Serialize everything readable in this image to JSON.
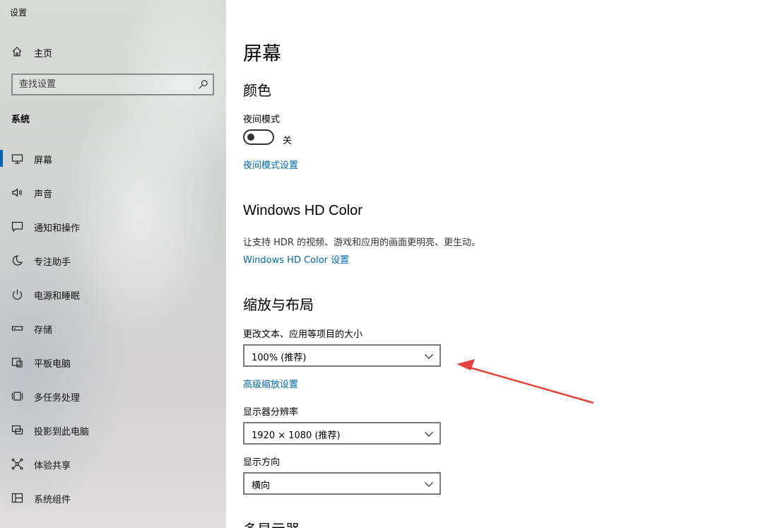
{
  "app": {
    "title": "设置"
  },
  "sidebar": {
    "home_label": "主页",
    "search_placeholder": "查找设置",
    "section_label": "系统",
    "items": [
      {
        "label": "屏幕",
        "icon": "monitor-icon",
        "active": true
      },
      {
        "label": "声音",
        "icon": "speaker-icon"
      },
      {
        "label": "通知和操作",
        "icon": "notification-icon"
      },
      {
        "label": "专注助手",
        "icon": "moon-icon"
      },
      {
        "label": "电源和睡眠",
        "icon": "power-icon"
      },
      {
        "label": "存储",
        "icon": "storage-icon"
      },
      {
        "label": "平板电脑",
        "icon": "tablet-icon"
      },
      {
        "label": "多任务处理",
        "icon": "multitask-icon"
      },
      {
        "label": "投影到此电脑",
        "icon": "project-icon"
      },
      {
        "label": "体验共享",
        "icon": "share-icon"
      },
      {
        "label": "系统组件",
        "icon": "components-icon"
      }
    ]
  },
  "main": {
    "page_title": "屏幕",
    "color": {
      "heading": "颜色",
      "night_mode_label": "夜间模式",
      "night_mode_state": "关",
      "night_mode_link": "夜间模式设置"
    },
    "hdr": {
      "heading": "Windows HD Color",
      "description": "让支持 HDR 的视频、游戏和应用的画面更明亮、更生动。",
      "link": "Windows HD Color 设置"
    },
    "scale": {
      "heading": "缩放与布局",
      "size_label": "更改文本、应用等项目的大小",
      "size_value": "100% (推荐)",
      "advanced_link": "高级缩放设置",
      "resolution_label": "显示器分辨率",
      "resolution_value": "1920 × 1080 (推荐)",
      "orientation_label": "显示方向",
      "orientation_value": "横向"
    },
    "multi_display_heading": "多显示器"
  },
  "colors": {
    "accent": "#0063b1",
    "link": "#0067b8",
    "annotation_arrow": "#e0443a"
  }
}
